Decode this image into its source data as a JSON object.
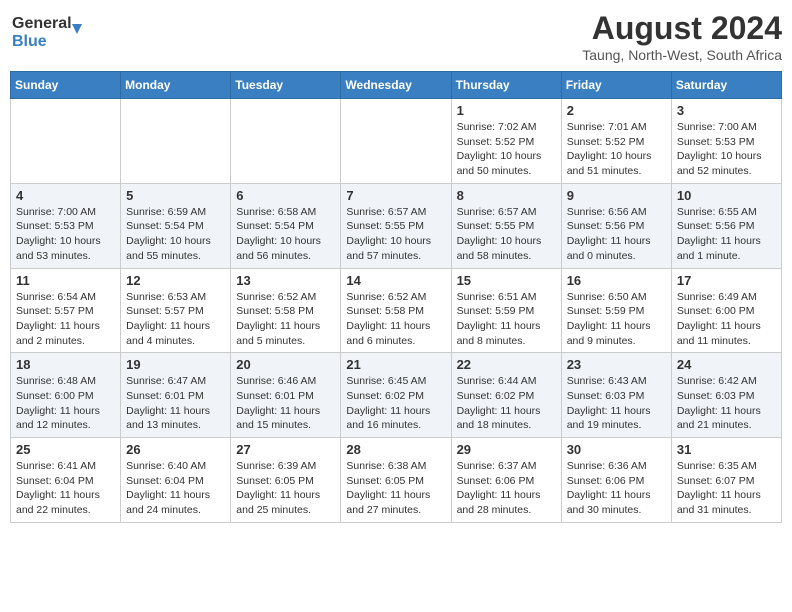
{
  "header": {
    "logo_line1": "General",
    "logo_line2": "Blue",
    "month": "August 2024",
    "location": "Taung, North-West, South Africa"
  },
  "weekdays": [
    "Sunday",
    "Monday",
    "Tuesday",
    "Wednesday",
    "Thursday",
    "Friday",
    "Saturday"
  ],
  "weeks": [
    [
      {
        "day": "",
        "info": ""
      },
      {
        "day": "",
        "info": ""
      },
      {
        "day": "",
        "info": ""
      },
      {
        "day": "",
        "info": ""
      },
      {
        "day": "1",
        "info": "Sunrise: 7:02 AM\nSunset: 5:52 PM\nDaylight: 10 hours\nand 50 minutes."
      },
      {
        "day": "2",
        "info": "Sunrise: 7:01 AM\nSunset: 5:52 PM\nDaylight: 10 hours\nand 51 minutes."
      },
      {
        "day": "3",
        "info": "Sunrise: 7:00 AM\nSunset: 5:53 PM\nDaylight: 10 hours\nand 52 minutes."
      }
    ],
    [
      {
        "day": "4",
        "info": "Sunrise: 7:00 AM\nSunset: 5:53 PM\nDaylight: 10 hours\nand 53 minutes."
      },
      {
        "day": "5",
        "info": "Sunrise: 6:59 AM\nSunset: 5:54 PM\nDaylight: 10 hours\nand 55 minutes."
      },
      {
        "day": "6",
        "info": "Sunrise: 6:58 AM\nSunset: 5:54 PM\nDaylight: 10 hours\nand 56 minutes."
      },
      {
        "day": "7",
        "info": "Sunrise: 6:57 AM\nSunset: 5:55 PM\nDaylight: 10 hours\nand 57 minutes."
      },
      {
        "day": "8",
        "info": "Sunrise: 6:57 AM\nSunset: 5:55 PM\nDaylight: 10 hours\nand 58 minutes."
      },
      {
        "day": "9",
        "info": "Sunrise: 6:56 AM\nSunset: 5:56 PM\nDaylight: 11 hours\nand 0 minutes."
      },
      {
        "day": "10",
        "info": "Sunrise: 6:55 AM\nSunset: 5:56 PM\nDaylight: 11 hours\nand 1 minute."
      }
    ],
    [
      {
        "day": "11",
        "info": "Sunrise: 6:54 AM\nSunset: 5:57 PM\nDaylight: 11 hours\nand 2 minutes."
      },
      {
        "day": "12",
        "info": "Sunrise: 6:53 AM\nSunset: 5:57 PM\nDaylight: 11 hours\nand 4 minutes."
      },
      {
        "day": "13",
        "info": "Sunrise: 6:52 AM\nSunset: 5:58 PM\nDaylight: 11 hours\nand 5 minutes."
      },
      {
        "day": "14",
        "info": "Sunrise: 6:52 AM\nSunset: 5:58 PM\nDaylight: 11 hours\nand 6 minutes."
      },
      {
        "day": "15",
        "info": "Sunrise: 6:51 AM\nSunset: 5:59 PM\nDaylight: 11 hours\nand 8 minutes."
      },
      {
        "day": "16",
        "info": "Sunrise: 6:50 AM\nSunset: 5:59 PM\nDaylight: 11 hours\nand 9 minutes."
      },
      {
        "day": "17",
        "info": "Sunrise: 6:49 AM\nSunset: 6:00 PM\nDaylight: 11 hours\nand 11 minutes."
      }
    ],
    [
      {
        "day": "18",
        "info": "Sunrise: 6:48 AM\nSunset: 6:00 PM\nDaylight: 11 hours\nand 12 minutes."
      },
      {
        "day": "19",
        "info": "Sunrise: 6:47 AM\nSunset: 6:01 PM\nDaylight: 11 hours\nand 13 minutes."
      },
      {
        "day": "20",
        "info": "Sunrise: 6:46 AM\nSunset: 6:01 PM\nDaylight: 11 hours\nand 15 minutes."
      },
      {
        "day": "21",
        "info": "Sunrise: 6:45 AM\nSunset: 6:02 PM\nDaylight: 11 hours\nand 16 minutes."
      },
      {
        "day": "22",
        "info": "Sunrise: 6:44 AM\nSunset: 6:02 PM\nDaylight: 11 hours\nand 18 minutes."
      },
      {
        "day": "23",
        "info": "Sunrise: 6:43 AM\nSunset: 6:03 PM\nDaylight: 11 hours\nand 19 minutes."
      },
      {
        "day": "24",
        "info": "Sunrise: 6:42 AM\nSunset: 6:03 PM\nDaylight: 11 hours\nand 21 minutes."
      }
    ],
    [
      {
        "day": "25",
        "info": "Sunrise: 6:41 AM\nSunset: 6:04 PM\nDaylight: 11 hours\nand 22 minutes."
      },
      {
        "day": "26",
        "info": "Sunrise: 6:40 AM\nSunset: 6:04 PM\nDaylight: 11 hours\nand 24 minutes."
      },
      {
        "day": "27",
        "info": "Sunrise: 6:39 AM\nSunset: 6:05 PM\nDaylight: 11 hours\nand 25 minutes."
      },
      {
        "day": "28",
        "info": "Sunrise: 6:38 AM\nSunset: 6:05 PM\nDaylight: 11 hours\nand 27 minutes."
      },
      {
        "day": "29",
        "info": "Sunrise: 6:37 AM\nSunset: 6:06 PM\nDaylight: 11 hours\nand 28 minutes."
      },
      {
        "day": "30",
        "info": "Sunrise: 6:36 AM\nSunset: 6:06 PM\nDaylight: 11 hours\nand 30 minutes."
      },
      {
        "day": "31",
        "info": "Sunrise: 6:35 AM\nSunset: 6:07 PM\nDaylight: 11 hours\nand 31 minutes."
      }
    ]
  ]
}
